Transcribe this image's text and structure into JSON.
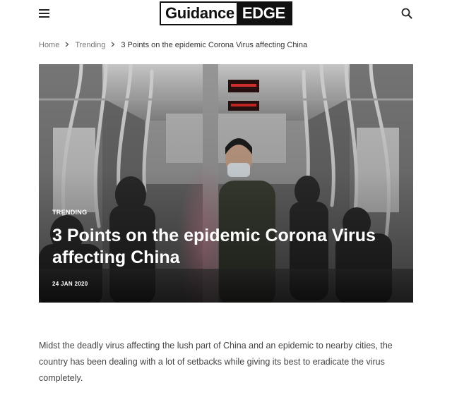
{
  "header": {
    "menu_icon": "hamburger-menu-icon",
    "logo": {
      "left": "Guidance",
      "right": "EDGE"
    },
    "search_icon": "search-icon"
  },
  "breadcrumb": {
    "items": [
      "Home",
      "Trending",
      "3 Points on the epidemic Corona Virus affecting China"
    ],
    "separator_icon": "chevron-right-icon"
  },
  "hero": {
    "category": "TRENDING",
    "title": "3 Points on the epidemic Corona Virus affecting China",
    "date": "24 JAN 2020",
    "image": "masked-man-in-subway-train-photo"
  },
  "article": {
    "paragraph": "Midst the deadly virus affecting the lush part of China and an epidemic to nearby cities, the country has been dealing with a lot of setbacks while giving its best to eradicate the virus completely."
  },
  "colors": {
    "text_dark": "#222222",
    "text_muted": "#777777",
    "logo_black": "#111111",
    "white": "#ffffff"
  }
}
